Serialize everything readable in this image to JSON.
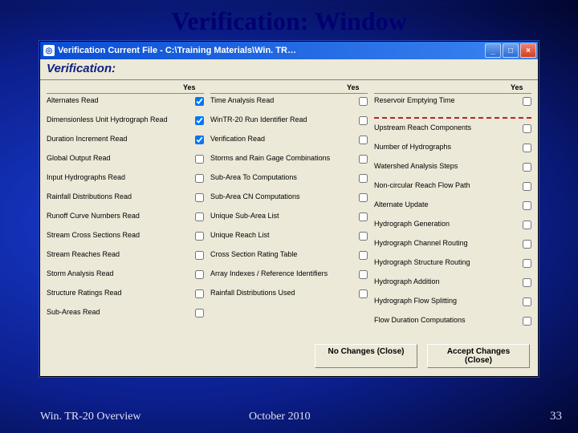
{
  "slide": {
    "title": "Verification: Window",
    "footer_left": "Win. TR-20 Overview",
    "footer_center": "October 2010",
    "page": "33"
  },
  "window": {
    "title": "Verification   Current File - C:\\Training Materials\\Win. TR…",
    "header": "Verification:",
    "yes": "Yes",
    "columns": [
      {
        "items": [
          {
            "label": "Alternates Read",
            "checked": true
          },
          {
            "label": "Dimensionless Unit Hydrograph Read",
            "checked": true
          },
          {
            "label": "Duration Increment Read",
            "checked": true
          },
          {
            "label": "Global Output Read",
            "checked": false
          },
          {
            "label": "Input Hydrographs Read",
            "checked": false
          },
          {
            "label": "Rainfall Distributions Read",
            "checked": false
          },
          {
            "label": "Runoff Curve Numbers Read",
            "checked": false
          },
          {
            "label": "Stream Cross Sections Read",
            "checked": false
          },
          {
            "label": "Stream Reaches Read",
            "checked": false
          },
          {
            "label": "Storm Analysis Read",
            "checked": false
          },
          {
            "label": "Structure Ratings Read",
            "checked": false
          },
          {
            "label": "Sub-Areas Read",
            "checked": false
          }
        ]
      },
      {
        "items": [
          {
            "label": "Time Analysis Read",
            "checked": false
          },
          {
            "label": "WinTR-20 Run Identifier Read",
            "checked": false
          },
          {
            "label": "Verification Read",
            "checked": false
          },
          {
            "label": "Storms and Rain Gage Combinations",
            "checked": false
          },
          {
            "label": "Sub-Area To Computations",
            "checked": false
          },
          {
            "label": "Sub-Area CN Computations",
            "checked": false
          },
          {
            "label": "Unique Sub-Area List",
            "checked": false
          },
          {
            "label": "Unique Reach List",
            "checked": false
          },
          {
            "label": "Cross Section Rating Table",
            "checked": false
          },
          {
            "label": "Array Indexes / Reference Identifiers",
            "checked": false
          },
          {
            "label": "Rainfall Distributions Used",
            "checked": false
          }
        ]
      },
      {
        "separator_after_index": 0,
        "items": [
          {
            "label": "Reservoir Emptying Time",
            "checked": false
          },
          {
            "label": "Upstream Reach Components",
            "checked": false
          },
          {
            "label": "Number of Hydrographs",
            "checked": false
          },
          {
            "label": "Watershed Analysis Steps",
            "checked": false
          },
          {
            "label": "Non-circular Reach Flow Path",
            "checked": false
          },
          {
            "label": "Alternate Update",
            "checked": false
          },
          {
            "label": "Hydrograph Generation",
            "checked": false
          },
          {
            "label": "Hydrograph Channel Routing",
            "checked": false
          },
          {
            "label": "Hydrograph Structure Routing",
            "checked": false
          },
          {
            "label": "Hydrograph Addition",
            "checked": false
          },
          {
            "label": "Hydrograph Flow Splitting",
            "checked": false
          },
          {
            "label": "Flow Duration Computations",
            "checked": false
          }
        ]
      }
    ],
    "buttons": {
      "no_changes": "No Changes (Close)",
      "accept": "Accept Changes (Close)"
    }
  }
}
